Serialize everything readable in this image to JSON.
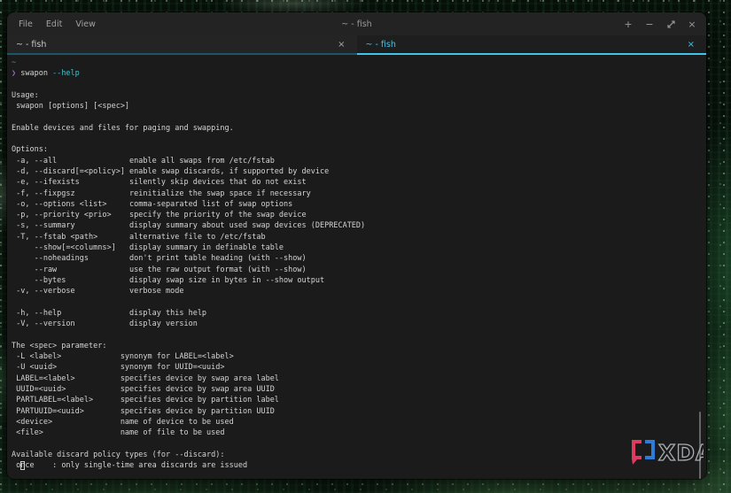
{
  "window": {
    "title": "~ - fish",
    "menu": [
      {
        "label": "File"
      },
      {
        "label": "Edit"
      },
      {
        "label": "View"
      }
    ],
    "controls": {
      "new_tab": "+",
      "minimize": "−",
      "close": "×"
    }
  },
  "tabs": [
    {
      "label": "~ - fish",
      "close": "×",
      "active": false
    },
    {
      "label": "~ - fish",
      "close": "×",
      "active": true
    }
  ],
  "terminal": {
    "cwd_line": "~",
    "prompt_char": "❯",
    "command": " swapon ",
    "flag": "--help",
    "output_lines": [
      "",
      "Usage:",
      " swapon [options] [<spec>]",
      "",
      "Enable devices and files for paging and swapping.",
      "",
      "Options:",
      " -a, --all                enable all swaps from /etc/fstab",
      " -d, --discard[=<policy>] enable swap discards, if supported by device",
      " -e, --ifexists           silently skip devices that do not exist",
      " -f, --fixpgsz            reinitialize the swap space if necessary",
      " -o, --options <list>     comma-separated list of swap options",
      " -p, --priority <prio>    specify the priority of the swap device",
      " -s, --summary            display summary about used swap devices (DEPRECATED)",
      " -T, --fstab <path>       alternative file to /etc/fstab",
      "     --show[=<columns>]   display summary in definable table",
      "     --noheadings         don't print table heading (with --show)",
      "     --raw                use the raw output format (with --show)",
      "     --bytes              display swap size in bytes in --show output",
      " -v, --verbose            verbose mode",
      "",
      " -h, --help               display this help",
      " -V, --version            display version",
      "",
      "The <spec> parameter:",
      " -L <label>             synonym for LABEL=<label>",
      " -U <uuid>              synonym for UUID=<uuid>",
      " LABEL=<label>          specifies device by swap area label",
      " UUID=<uuid>            specifies device by swap area UUID",
      " PARTLABEL=<label>      specifies device by partition label",
      " PARTUUID=<uuid>        specifies device by partition UUID",
      " <device>               name of device to be used",
      " <file>                 name of file to be used",
      "",
      "Available discard policy types (for --discard):"
    ],
    "cursor_line": {
      "before": " o",
      "at_cursor": "n",
      "after": "ce    : only single-time area discards are issued"
    }
  },
  "watermark": {
    "text": "XDA"
  },
  "colors": {
    "accent_cyan": "#41c4e8",
    "inactive_tab_underline": "#1d5666",
    "prompt_purple": "#9a63c8",
    "flag_cyan": "#3fc0c8",
    "terminal_fg": "#d4d4d4",
    "terminal_bg": "#1b1b1b",
    "chrome_bg": "#232323",
    "xda_red": "#e23a5e",
    "xda_blue": "#2f7cd8"
  }
}
